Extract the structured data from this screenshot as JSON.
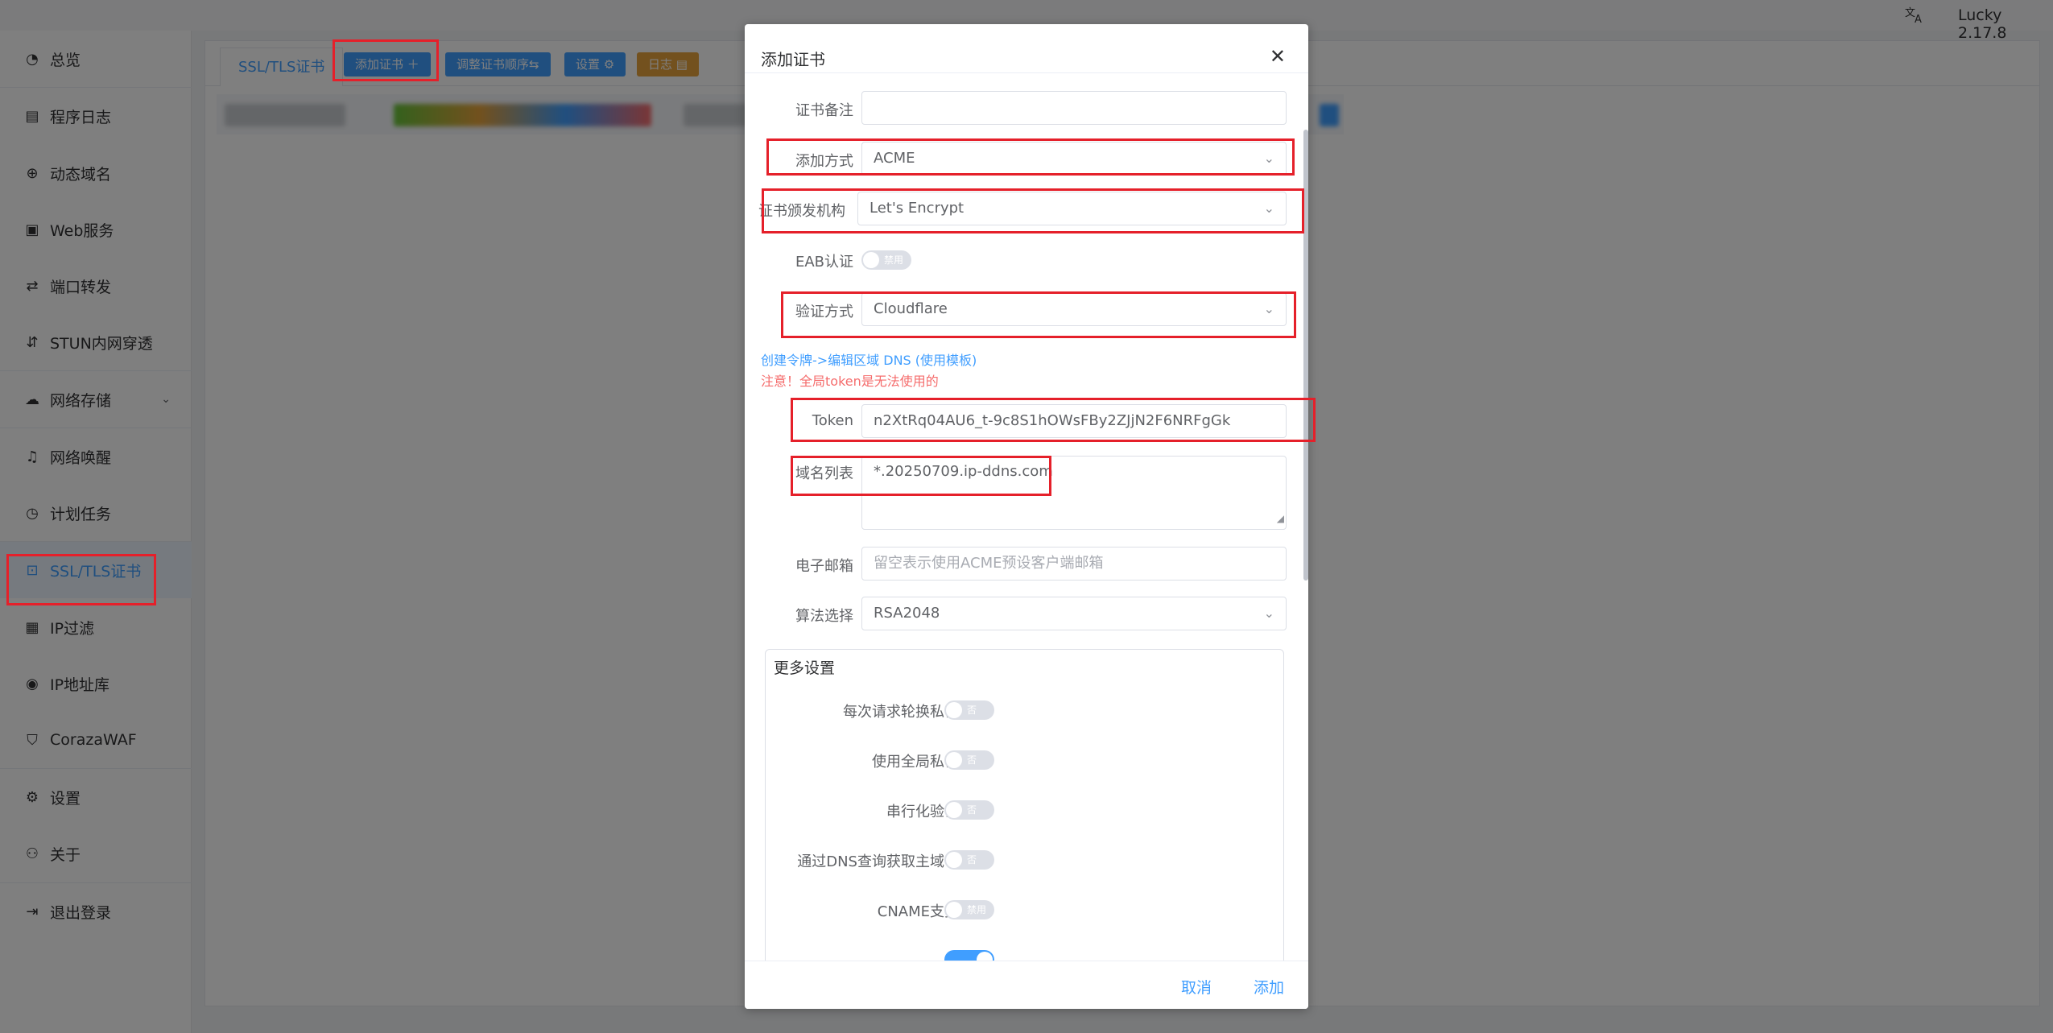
{
  "topbar": {
    "lang_icon": "translate-icon",
    "version": "Lucky 2.17.8"
  },
  "sidebar": {
    "items": [
      {
        "label": "总览",
        "icon": "dashboard-icon"
      },
      {
        "label": "程序日志",
        "icon": "log-icon"
      },
      {
        "label": "动态域名",
        "icon": "ddns-icon"
      },
      {
        "label": "Web服务",
        "icon": "web-icon"
      },
      {
        "label": "端口转发",
        "icon": "port-forward-icon"
      },
      {
        "label": "STUN内网穿透",
        "icon": "stun-icon"
      },
      {
        "label": "网络存储",
        "icon": "cloud-storage-icon"
      },
      {
        "label": "网络唤醒",
        "icon": "bell-icon"
      },
      {
        "label": "计划任务",
        "icon": "clock-icon"
      },
      {
        "label": "SSL/TLS证书",
        "icon": "certificate-icon"
      },
      {
        "label": "IP过滤",
        "icon": "filter-icon"
      },
      {
        "label": "IP地址库",
        "icon": "ip-db-icon"
      },
      {
        "label": "CorazaWAF",
        "icon": "shield-icon"
      },
      {
        "label": "设置",
        "icon": "gear-icon"
      },
      {
        "label": "关于",
        "icon": "about-icon"
      },
      {
        "label": "退出登录",
        "icon": "logout-icon"
      }
    ]
  },
  "main": {
    "tab": "SSL/TLS证书",
    "buttons": {
      "add_cert": "添加证书 ＋",
      "reorder": "调整证书顺序⇆",
      "settings": "设置 ⚙",
      "log": "日志 ▤"
    },
    "colors": {
      "primary": "#409eff",
      "warning": "#e6a23c",
      "highlight": "#e5202a"
    }
  },
  "dialog": {
    "title": "添加证书",
    "fields": {
      "remark_label": "证书备注",
      "remark_value": "",
      "add_method_label": "添加方式",
      "add_method_value": "ACME",
      "ca_label": "证书颁发机构",
      "ca_value": "Let's Encrypt",
      "eab_label": "EAB认证",
      "eab_state": "禁用",
      "verify_label": "验证方式",
      "verify_value": "Cloudflare",
      "create_token_link": "创建令牌->编辑区域 DNS (使用模板)",
      "token_warning": "注意！全局token是无法使用的",
      "token_label": "Token",
      "token_value": "n2XtRq04AU6_t-9c8S1hOWsFBy2ZJjN2F6NRFgGk",
      "domains_label": "域名列表",
      "domains_value": "*.20250709.ip-ddns.com",
      "email_label": "电子邮箱",
      "email_placeholder": "留空表示使用ACME预设客户端邮箱",
      "algo_label": "算法选择",
      "algo_value": "RSA2048"
    },
    "more": {
      "title": "更多设置",
      "options": [
        {
          "label": "每次请求轮换私钥",
          "state": "否"
        },
        {
          "label": "使用全局私钥",
          "state": "否"
        },
        {
          "label": "串行化验证",
          "state": "否"
        },
        {
          "label": "通过DNS查询获取主域名",
          "state": "否"
        },
        {
          "label": "CNAME支持",
          "state": "禁用"
        }
      ]
    },
    "footer": {
      "cancel": "取消",
      "confirm": "添加"
    }
  }
}
